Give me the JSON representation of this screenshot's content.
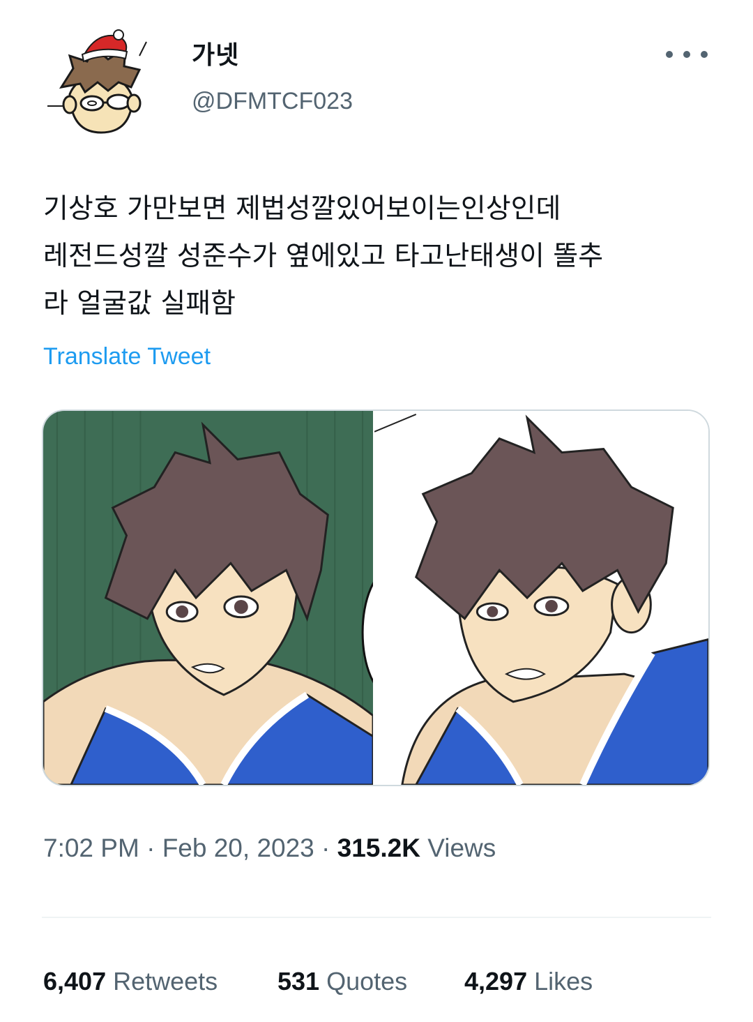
{
  "author": {
    "display_name": "가넷",
    "handle": "@DFMTCF023",
    "avatar_icon": "cartoon-avatar-santa-hat"
  },
  "tweet": {
    "text": "기상호 가만보면 제법성깔있어보이는인상인데\n레전드성깔 성준수가 옆에있고 타고난태생이 똘추\n라 얼굴값 실패함",
    "translate_label": "Translate Tweet"
  },
  "meta": {
    "time": "7:02 PM",
    "separator": "·",
    "date": "Feb 20, 2023",
    "views_count": "315.2K",
    "views_label": "Views"
  },
  "stats": {
    "retweets_count": "6,407",
    "retweets_label": "Retweets",
    "quotes_count": "531",
    "quotes_label": "Quotes",
    "likes_count": "4,297",
    "likes_label": "Likes"
  },
  "colors": {
    "accent": "#1d9bf0",
    "secondary_text": "#536471",
    "primary_text": "#0f1419",
    "border": "#cfd9de"
  }
}
